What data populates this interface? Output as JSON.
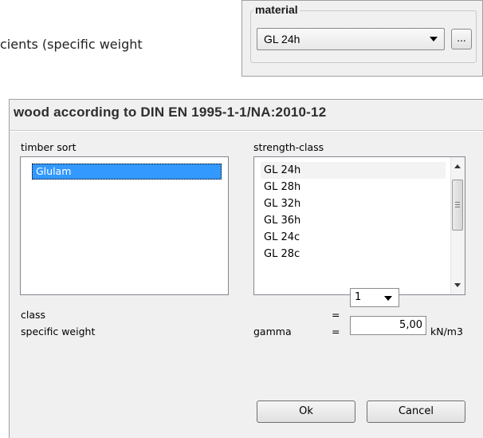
{
  "background_fragment": {
    "text": "cients (specific weight"
  },
  "material_panel": {
    "legend": "material",
    "selected": "GL 24h",
    "browse_label": "..."
  },
  "dialog": {
    "title": "wood according to DIN EN 1995-1-1/NA:2010-12",
    "timber_sort": {
      "label": "timber sort",
      "items": [
        "Glulam"
      ],
      "selected_index": 0
    },
    "strength_class": {
      "label": "strength-class",
      "items": [
        "GL 24h",
        "GL 28h",
        "GL 32h",
        "GL 36h",
        "GL 24c",
        "GL 28c"
      ],
      "selected_index": 0
    },
    "class_row": {
      "label": "class",
      "equals": "=",
      "value": "1"
    },
    "specific_weight_row": {
      "label": "specific weight",
      "symbol": "gamma",
      "equals": "=",
      "value": "5,00",
      "unit": "kN/m3"
    },
    "buttons": {
      "ok": "Ok",
      "cancel": "Cancel"
    }
  },
  "colors": {
    "selection": "#3399ff",
    "dialog_bg": "#f0f0f0"
  }
}
